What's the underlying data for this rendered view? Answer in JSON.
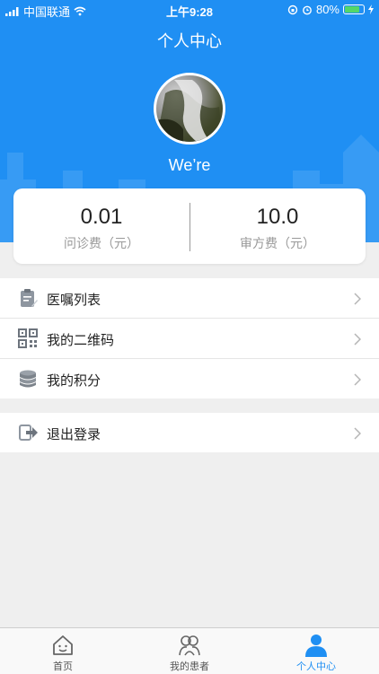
{
  "status_bar": {
    "carrier": "中国联通",
    "time": "上午9:28",
    "battery": "80%",
    "battery_level": 0.8
  },
  "header": {
    "title": "个人中心",
    "username": "We’re"
  },
  "fees": [
    {
      "value": "0.01",
      "label": "问诊费（元）"
    },
    {
      "value": "10.0",
      "label": "审方费（元）"
    }
  ],
  "menu": [
    {
      "label": "医嘱列表",
      "icon": "clipboard-icon"
    },
    {
      "label": "我的二维码",
      "icon": "qr-code-icon"
    },
    {
      "label": "我的积分",
      "icon": "coins-icon"
    }
  ],
  "logout": {
    "label": "退出登录",
    "icon": "logout-icon"
  },
  "tabs": [
    {
      "label": "首页",
      "icon": "home-icon",
      "active": false
    },
    {
      "label": "我的患者",
      "icon": "patients-icon",
      "active": false
    },
    {
      "label": "个人中心",
      "icon": "person-icon",
      "active": true
    }
  ],
  "colors": {
    "accent": "#1f8ff3",
    "background": "#efefef"
  }
}
